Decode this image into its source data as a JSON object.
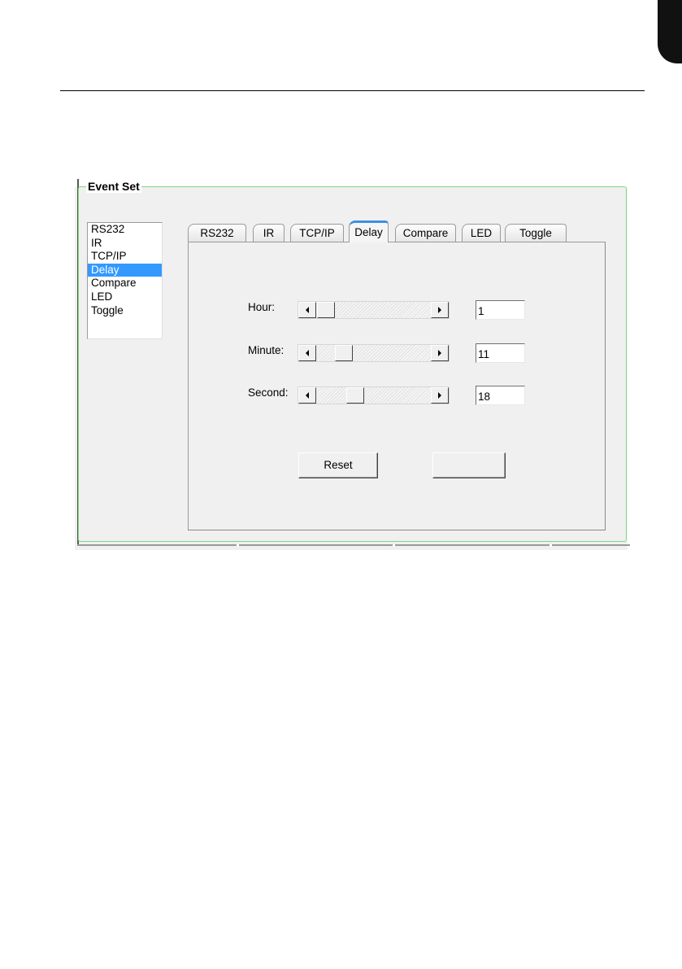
{
  "group_title": "Event Set",
  "list": {
    "items": [
      "RS232",
      "IR",
      "TCP/IP",
      "Delay",
      "Compare",
      "LED",
      "Toggle"
    ],
    "selected_index": 3
  },
  "tabs": {
    "items": [
      "RS232",
      "IR",
      "TCP/IP",
      "Delay",
      "Compare",
      "LED",
      "Toggle"
    ],
    "active_index": 3
  },
  "delay": {
    "hour_label": "Hour:",
    "minute_label": "Minute:",
    "second_label": "Second:",
    "hour_value": "1",
    "minute_value": "11",
    "second_value": "18",
    "hour_fraction": 0.01,
    "minute_fraction": 0.19,
    "second_fraction": 0.31
  },
  "buttons": {
    "reset_label": "Reset",
    "second_label": ""
  },
  "colors": {
    "highlight": "#1aa84a",
    "selection": "#3399ff",
    "active_tab": "#3c8fe0"
  }
}
